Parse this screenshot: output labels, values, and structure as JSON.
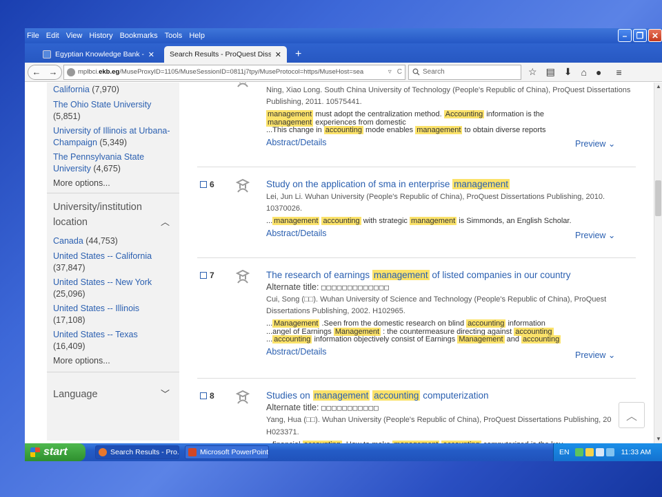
{
  "menubar": [
    "File",
    "Edit",
    "View",
    "History",
    "Bookmarks",
    "Tools",
    "Help"
  ],
  "window_controls": {
    "minimize": "–",
    "maximize": "❐",
    "close": "✕"
  },
  "tabs": [
    {
      "label": "Egyptian Knowledge Bank - S...",
      "close": "✕",
      "active": false
    },
    {
      "label": "Search Results - ProQuest Dissert...",
      "close": "✕",
      "active": true
    }
  ],
  "new_tab_label": "+",
  "nav": {
    "back": "←",
    "forward": "→",
    "url_prefix": "mplbci.",
    "url_host": "ekb.eg",
    "url_rest": "/MuseProxyID=1105/MuseSessionID=0811j7tpy/MuseProtocol=https/MuseHost=sea",
    "url_dropdown": "▿",
    "reload": "C",
    "search_placeholder": "Search"
  },
  "sidebar": {
    "top_facets": [
      {
        "label": "California",
        "count": "(7,970)"
      },
      {
        "label": "The Ohio State University",
        "count": "(5,851)"
      },
      {
        "label": "University of Illinois at Urbana-Champaign",
        "count": "(5,349)"
      },
      {
        "label": "The Pennsylvania State University",
        "count": "(4,675)"
      }
    ],
    "more_options_1": "More options...",
    "location_heading": "University/institution location",
    "location_facets": [
      {
        "label": "Canada",
        "count": "(44,753)"
      },
      {
        "label": "United States -- California",
        "count": "(37,847)"
      },
      {
        "label": "United States -- New York",
        "count": "(25,096)"
      },
      {
        "label": "United States -- Illinois",
        "count": "(17,108)"
      },
      {
        "label": "United States -- Texas",
        "count": "(16,409)"
      }
    ],
    "more_options_2": "More options...",
    "language_heading": "Language"
  },
  "results": [
    {
      "number": "",
      "title": "",
      "meta": "Ning, Xiao Long. South China University of Technology (People's Republic of China), ProQuest Dissertations Publishing, 2011. 10575441.",
      "snippets": [
        [
          {
            "t": "management",
            "h": true
          },
          {
            "t": " must adopt the centralization method. ",
            "h": false
          },
          {
            "t": "Accounting",
            "h": true
          },
          {
            "t": " information is the",
            "h": false
          }
        ],
        [
          {
            "t": "management",
            "h": true
          },
          {
            "t": " experiences from domestic",
            "h": false
          }
        ],
        [
          {
            "t": "...This change in ",
            "h": false
          },
          {
            "t": "accounting",
            "h": true
          },
          {
            "t": " mode enables ",
            "h": false
          },
          {
            "t": "management",
            "h": true
          },
          {
            "t": " to obtain diverse reports",
            "h": false
          }
        ]
      ],
      "abstract": "Abstract/Details",
      "preview": "Preview ⌄"
    },
    {
      "number": "6",
      "title_parts": [
        {
          "t": "Study on the application of sma in enterprise ",
          "h": false
        },
        {
          "t": "management",
          "h": true
        }
      ],
      "meta": "Lei, Jun Li. Wuhan University (People's Republic of China), ProQuest Dissertations Publishing, 2010. 10370026.",
      "snippets": [
        [
          {
            "t": "...",
            "h": false
          },
          {
            "t": "management",
            "h": true
          },
          {
            "t": " ",
            "h": false
          },
          {
            "t": "accounting",
            "h": true
          },
          {
            "t": " with strategic ",
            "h": false
          },
          {
            "t": "management",
            "h": true
          },
          {
            "t": " is Simmonds, an English Scholar.",
            "h": false
          }
        ]
      ],
      "abstract": "Abstract/Details",
      "preview": "Preview ⌄"
    },
    {
      "number": "7",
      "title_parts": [
        {
          "t": "The research of earnings ",
          "h": false
        },
        {
          "t": "management",
          "h": true
        },
        {
          "t": " of listed companies in our country",
          "h": false
        }
      ],
      "alt_label": "Alternate title: ",
      "alt_boxes": "□□□□□□□□□□□□□",
      "meta": "Cui, Song (□□). Wuhan University of Science and Technology (People's Republic of China), ProQuest Dissertations Publishing, 2002. H102965.",
      "snippets": [
        [
          {
            "t": "...",
            "h": false
          },
          {
            "t": "Management",
            "h": true
          },
          {
            "t": " .Seen from the domestic research on blind ",
            "h": false
          },
          {
            "t": "accounting",
            "h": true
          },
          {
            "t": " information",
            "h": false
          }
        ],
        [
          {
            "t": "...angel of Earnings ",
            "h": false
          },
          {
            "t": "Management",
            "h": true
          },
          {
            "t": " : the countermeasure directing against ",
            "h": false
          },
          {
            "t": "accounting",
            "h": true
          }
        ],
        [
          {
            "t": "...",
            "h": false
          },
          {
            "t": "accounting",
            "h": true
          },
          {
            "t": " information objectively consist of Earnings ",
            "h": false
          },
          {
            "t": "Management",
            "h": true
          },
          {
            "t": " and ",
            "h": false
          },
          {
            "t": "accounting",
            "h": true
          }
        ]
      ],
      "abstract": "Abstract/Details",
      "preview": "Preview ⌄"
    },
    {
      "number": "8",
      "title_parts": [
        {
          "t": "Studies on ",
          "h": false
        },
        {
          "t": "management",
          "h": true
        },
        {
          "t": " ",
          "h": false
        },
        {
          "t": "accounting",
          "h": true
        },
        {
          "t": " computerization",
          "h": false
        }
      ],
      "alt_label": "Alternate title: ",
      "alt_boxes": "□□□□□□□□□□□",
      "meta": "Yang, Hua (□□). Wuhan University (People's Republic of China), ProQuest Dissertations Publishing, 20",
      "meta2": "H023371.",
      "snippets": [
        [
          {
            "t": "...financial ",
            "h": false
          },
          {
            "t": "accounting",
            "h": true
          },
          {
            "t": " .How to make ",
            "h": false
          },
          {
            "t": "management",
            "h": true
          },
          {
            "t": " ",
            "h": false
          },
          {
            "t": "accounting",
            "h": true
          },
          {
            "t": " computerized is the key",
            "h": false
          }
        ]
      ]
    }
  ],
  "back_to_top": "︿",
  "taskbar": {
    "start": "start",
    "items": [
      "Search Results - Pro...",
      "Microsoft PowerPoint ..."
    ],
    "lang": "EN",
    "clock": "11:33 AM"
  }
}
